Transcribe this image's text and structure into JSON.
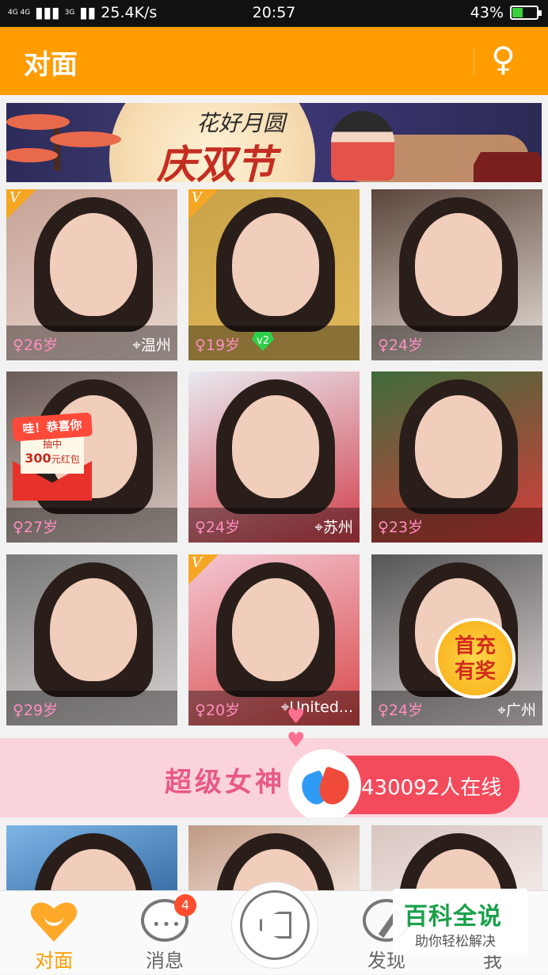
{
  "status_bar": {
    "network_left": "4G 4G",
    "network_3g": "3G",
    "speed": "25.4K/s",
    "time": "20:57",
    "battery_pct": "43%",
    "battery_level": 0.43
  },
  "header": {
    "title": "对面",
    "gender_icon": "♀"
  },
  "banner": {
    "line1": "花好月圆",
    "line2": "庆双节"
  },
  "cards": [
    {
      "age": "♀26岁",
      "location": "温州",
      "vip": true,
      "colors": [
        "#c7a295",
        "#e8d6cf"
      ]
    },
    {
      "age": "♀19岁",
      "location": "",
      "vip": true,
      "badge": "v2",
      "colors": [
        "#c9a24a",
        "#e0b95a"
      ]
    },
    {
      "age": "♀24岁",
      "location": "",
      "vip": false,
      "colors": [
        "#5b463c",
        "#e7dfd7"
      ]
    },
    {
      "age": "♀27岁",
      "location": "",
      "vip": false,
      "colors": [
        "#6a5c56",
        "#d7c8c2"
      ]
    },
    {
      "age": "♀24岁",
      "location": "苏州",
      "vip": false,
      "colors": [
        "#e9e9f0",
        "#d13e4a"
      ]
    },
    {
      "age": "♀23岁",
      "location": "",
      "vip": false,
      "colors": [
        "#3f6c3b",
        "#d93b3b"
      ]
    },
    {
      "age": "♀29岁",
      "location": "",
      "vip": false,
      "colors": [
        "#7a7a7a",
        "#d6d1cf"
      ]
    },
    {
      "age": "♀20岁",
      "location": "United...",
      "vip": true,
      "colors": [
        "#f3c7d3",
        "#d94848"
      ]
    },
    {
      "age": "♀24岁",
      "location": "广州",
      "vip": false,
      "colors": [
        "#565656",
        "#e3dad8"
      ]
    },
    {
      "age": "",
      "location": "",
      "vip": false,
      "colors": [
        "#7db6e6",
        "#3a6fa8"
      ]
    },
    {
      "age": "",
      "location": "",
      "vip": false,
      "colors": [
        "#c09a84",
        "#f0dfd6"
      ]
    },
    {
      "age": "",
      "location": "",
      "vip": false,
      "colors": [
        "#d8c5bf",
        "#f2e9e6"
      ]
    }
  ],
  "redpack": {
    "title": "哇！恭喜你",
    "line1": "抽中",
    "amount": "300",
    "unit": "元红包"
  },
  "first_charge": {
    "line1": "首充",
    "line2": "有奖"
  },
  "promo": {
    "text": "超级女神",
    "online": "430092人在线"
  },
  "tabbar": {
    "tabs": [
      {
        "label": "对面",
        "active": true
      },
      {
        "label": "消息",
        "active": false,
        "badge": "4"
      },
      {
        "label": "",
        "active": false
      },
      {
        "label": "发现",
        "active": false
      },
      {
        "label": "我",
        "active": false
      }
    ]
  },
  "watermark": {
    "big": "百科全说",
    "small": "助你轻松解决"
  }
}
